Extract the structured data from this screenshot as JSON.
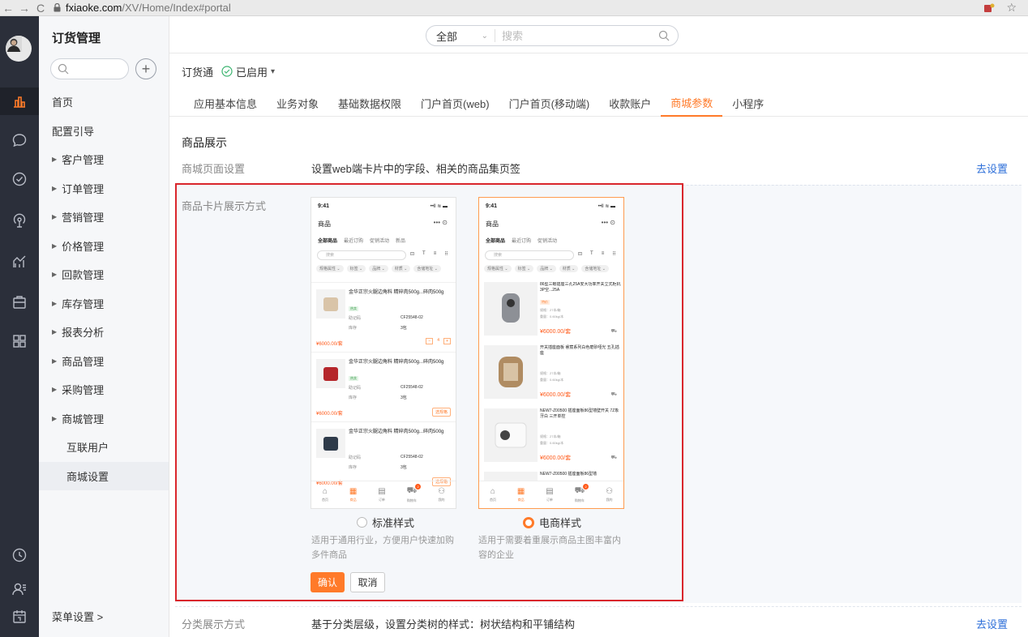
{
  "browser": {
    "back": "←",
    "forward": "→",
    "reload": "C",
    "url_host": "fxiaoke.com",
    "url_path": "/XV/Home/Index#portal",
    "star": "☆"
  },
  "sidebar": {
    "title": "订货管理",
    "items": [
      {
        "label": "首页",
        "has_arrow": false
      },
      {
        "label": "配置引导",
        "has_arrow": false
      },
      {
        "label": "客户管理",
        "has_arrow": true
      },
      {
        "label": "订单管理",
        "has_arrow": true
      },
      {
        "label": "营销管理",
        "has_arrow": true
      },
      {
        "label": "价格管理",
        "has_arrow": true
      },
      {
        "label": "回款管理",
        "has_arrow": true
      },
      {
        "label": "库存管理",
        "has_arrow": true
      },
      {
        "label": "报表分析",
        "has_arrow": true
      },
      {
        "label": "商品管理",
        "has_arrow": true
      },
      {
        "label": "采购管理",
        "has_arrow": true
      },
      {
        "label": "商城管理",
        "has_arrow": true
      },
      {
        "label": "互联用户",
        "has_arrow": false,
        "sub": true
      },
      {
        "label": "商城设置",
        "has_arrow": false,
        "sub": true,
        "selected": true
      }
    ],
    "bottom": "菜单设置 >"
  },
  "header": {
    "scope": "全部",
    "search_placeholder": "搜索"
  },
  "app": {
    "name": "订货通",
    "status": "已启用",
    "status_arrow": "▾"
  },
  "tabs": [
    {
      "label": "应用基本信息",
      "active": false
    },
    {
      "label": "业务对象",
      "active": false
    },
    {
      "label": "基础数据权限",
      "active": false
    },
    {
      "label": "门户首页(web)",
      "active": false
    },
    {
      "label": "门户首页(移动端)",
      "active": false
    },
    {
      "label": "收款账户",
      "active": false
    },
    {
      "label": "商城参数",
      "active": true
    },
    {
      "label": "小程序",
      "active": false
    }
  ],
  "section": {
    "title": "商品展示",
    "page_setting_label": "商城页面设置",
    "page_setting_desc": "设置web端卡片中的字段、相关的商品集页签",
    "page_setting_link": "去设置",
    "card_label": "商品卡片展示方式",
    "category_label": "分类展示方式",
    "category_desc": "基于分类层级，设置分类树的样式：树状结构和平铺结构",
    "category_link": "去设置"
  },
  "preview": {
    "time": "9:41",
    "signal": "••ll ≋ ▬",
    "page_title": "商品",
    "more": "••• ⊙",
    "tabs_standard": [
      "全部商品",
      "最近订购",
      "促销活动",
      "新品"
    ],
    "tabs_ecom": [
      "全部商品",
      "最近订购",
      "促销活动"
    ],
    "search": "搜索",
    "tools": [
      "⊡",
      "T",
      "≡",
      "⠿"
    ],
    "filters": [
      "规格属性 ⌄",
      "标签 ⌄",
      "品牌 ⌄",
      "材质 ⌄",
      "含储地址 ⌄"
    ],
    "standard_products": [
      {
        "name": "金华正宗火腿边角料 精碎肉500g...碎肉500g",
        "tag": "热卖",
        "code_label": "助记码",
        "code": "CF25548-02",
        "stock_label": "库存",
        "stock": "3包",
        "price": "¥6000.00/套",
        "action": "stepper",
        "qty": "4"
      },
      {
        "name": "金华正宗火腿边角料 精碎肉500g...碎肉500g",
        "tag": "热卖",
        "code_label": "助记码",
        "code": "CF25548-02",
        "stock_label": "库存",
        "stock": "3包",
        "price": "¥6000.00/套",
        "action": "选规格"
      },
      {
        "name": "金华正宗火腿边角料 精碎肉500g...碎肉500g",
        "tag": "",
        "code_label": "助记码",
        "code": "CF25548-02",
        "stock_label": "库存",
        "stock": "3包",
        "price": "¥6000.00/套",
        "action": "选规格"
      }
    ],
    "ecom_products": [
      {
        "name": "86型三眼插座三孔25A安大功率开关立式柜机3P空...25A",
        "tag": "特价",
        "spec1": "规格：27本/箱",
        "spec2": "重量：0.60kg/本",
        "price": "¥6000.00/套"
      },
      {
        "name": "开关插座面板 睿宸系列白色磨砂哑光 五孔插座",
        "tag": "",
        "spec1": "规格：27本/箱",
        "spec2": "重量：0.60kg/本",
        "price": "¥6000.00/套"
      },
      {
        "name": "NEW7-Z00500 插座面板86型墙壁开关 7Z象牙白 三开单控",
        "tag": "",
        "spec1": "规格：27本/箱",
        "spec2": "重量：0.60kg/本",
        "price": "¥6000.00/套"
      },
      {
        "name": "NEW7-Z00500 插座面板86型墙",
        "tag": "",
        "spec1": "",
        "spec2": "",
        "price": ""
      }
    ],
    "nav": [
      "首页",
      "商品",
      "订单",
      "购物车",
      "我的"
    ],
    "cart_badge": "2"
  },
  "options": {
    "standard_label": "标准样式",
    "standard_desc": "适用于通用行业，方便用户快速加购多件商品",
    "ecom_label": "电商样式",
    "ecom_desc": "适用于需要着重展示商品主图丰富内容的企业",
    "selected": "ecom"
  },
  "buttons": {
    "ok": "确认",
    "cancel": "取消"
  },
  "colors": {
    "accent": "#ff7a29",
    "link": "#2e6fd9",
    "rail_bg": "#2b2f3a",
    "highlight_border": "#d9262c"
  }
}
